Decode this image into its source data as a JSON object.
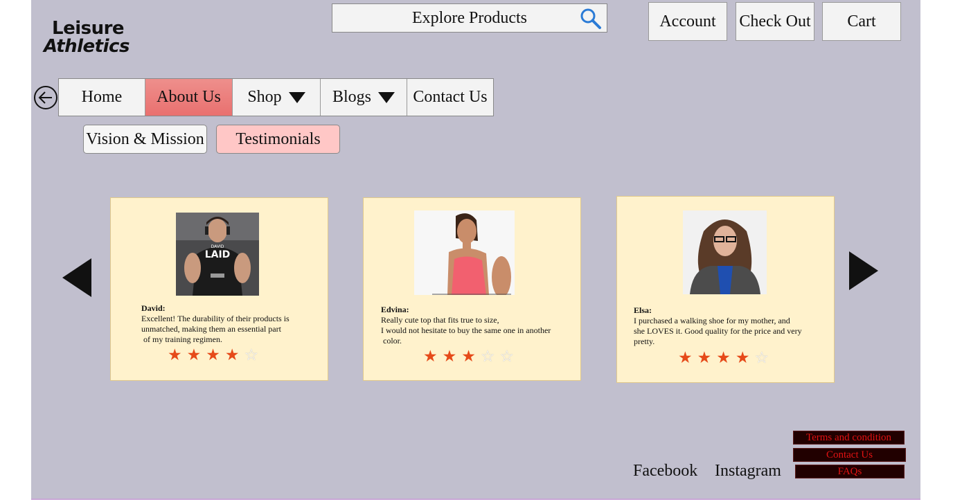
{
  "logo": {
    "line1": "Leisure",
    "line2": "Athletics"
  },
  "search": {
    "label": "Explore Products",
    "icon": "search-icon"
  },
  "header_buttons": {
    "account": "Account",
    "checkout": "Check Out",
    "cart": "Cart"
  },
  "nav": {
    "back_icon": "back-arrow-icon",
    "items": [
      {
        "label": "Home"
      },
      {
        "label": "About Us",
        "active": true
      },
      {
        "label": "Shop",
        "dropdown": true
      },
      {
        "label": "Blogs",
        "dropdown": true
      },
      {
        "label": "Contact Us"
      }
    ]
  },
  "subnav": {
    "vision": "Vision & Mission",
    "testimonials": "Testimonials"
  },
  "carousel": {
    "prev_icon": "triangle-left-icon",
    "next_icon": "triangle-right-icon",
    "testimonials": [
      {
        "name": "David:",
        "lines": [
          "Excellent! The durability of their products is",
          "unmatched, making them an essential part",
          " of my training regimen."
        ],
        "rating": 4,
        "max": 5,
        "shirt_text": "LAID",
        "shirt_small": "DAVID"
      },
      {
        "name": "Edvina:",
        "lines": [
          "Really cute top that fits true to size,",
          "I would not hesitate to buy the same one in another",
          " color."
        ],
        "rating": 3,
        "max": 5
      },
      {
        "name": "Elsa:",
        "lines": [
          "I purchased a walking shoe for my mother, and",
          "she LOVES it. Good quality for the price and very",
          "pretty."
        ],
        "rating": 4,
        "max": 5
      }
    ]
  },
  "footer": {
    "facebook": "Facebook",
    "instagram": "Instagram",
    "terms": "Terms and condition",
    "contact": "Contact Us",
    "faqs": "FAQs"
  },
  "colors": {
    "background": "#c1bfce",
    "card": "#fff2cc",
    "active_nav": "#ec8583",
    "testimonials_btn": "#ffc7c6",
    "star": "#e64a19",
    "footer_link_bg": "#210000",
    "footer_link_text": "#e21212"
  }
}
